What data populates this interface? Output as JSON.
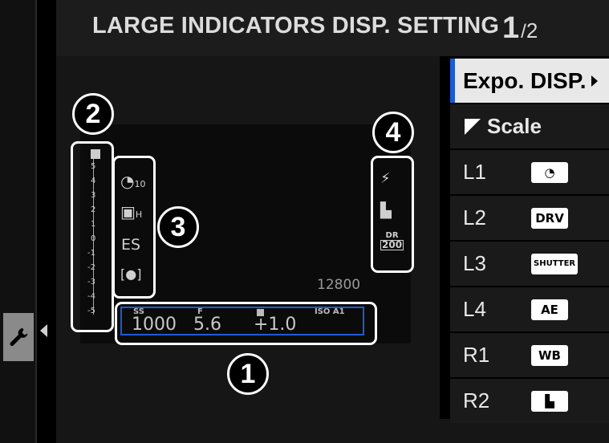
{
  "header": {
    "title": "LARGE INDICATORS DISP. SETTING",
    "page_current": "1",
    "page_total": "2"
  },
  "menu": {
    "items": [
      {
        "label": "Expo. DISP.",
        "selected": true
      },
      {
        "label": "Scale"
      },
      {
        "label": "L1",
        "icon": "self-timer-icon"
      },
      {
        "label": "L2",
        "badge": "DRV"
      },
      {
        "label": "L3",
        "badge": "SHUTTER"
      },
      {
        "label": "L4",
        "badge": "AE"
      },
      {
        "label": "R1",
        "badge": "WB"
      },
      {
        "label": "R2",
        "icon": "film-simulation-icon"
      }
    ]
  },
  "callouts": [
    "1",
    "2",
    "3",
    "4"
  ],
  "preview": {
    "exposure": {
      "ss_label": "SS",
      "ss_value": "1000",
      "f_label": "F",
      "f_value": "5.6",
      "comp_value": "+1.0",
      "iso_label": "ISO A1"
    },
    "iso_readout": "12800",
    "scale_labels": [
      "5",
      "4",
      "3",
      "2",
      "1",
      "0",
      "-1",
      "-2",
      "-3",
      "-4",
      "-5"
    ],
    "left_icons": {
      "timer_sub": "10",
      "drive_sub": "H",
      "shutter": "ES"
    },
    "right_icons": {
      "dr_top": "DR",
      "dr_val": "200"
    }
  },
  "colors": {
    "accent": "#1c5bd6",
    "selected_bg": "#e8e8e8",
    "menu_bg": "#1a1a1a"
  }
}
